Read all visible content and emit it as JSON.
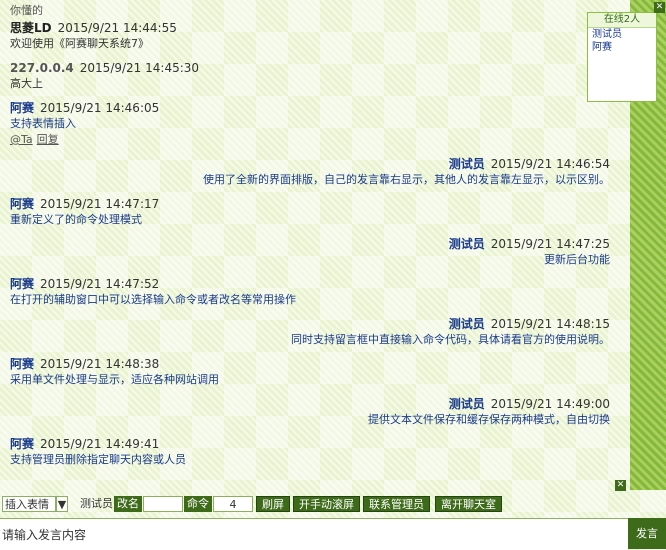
{
  "top_label": "你懂的",
  "online": {
    "header": "在线2人",
    "users": [
      "测试员",
      "阿赛"
    ]
  },
  "messages": [
    {
      "side": "left",
      "name": "思菱LD",
      "time": "2015/9/21 14:44:55",
      "text": "欢迎使用《阿赛聊天系统7》",
      "style": "dark"
    },
    {
      "side": "left",
      "name": "227.0.0.4",
      "time": "2015/9/21 14:45:30",
      "text": "高大上",
      "style": "gray"
    },
    {
      "side": "left",
      "name": "阿赛",
      "time": "2015/9/21 14:46:05",
      "text": "支持表情插入",
      "ops": [
        "@Ta",
        "回复"
      ]
    },
    {
      "side": "right",
      "name": "测试员",
      "time": "2015/9/21 14:46:54",
      "text": "使用了全新的界面排版，自己的发言靠右显示，其他人的发言靠左显示，以示区别。"
    },
    {
      "side": "left",
      "name": "阿赛",
      "time": "2015/9/21 14:47:17",
      "text": "重新定义了的命令处理模式"
    },
    {
      "side": "right",
      "name": "测试员",
      "time": "2015/9/21 14:47:25",
      "text": "更新后台功能"
    },
    {
      "side": "left",
      "name": "阿赛",
      "time": "2015/9/21 14:47:52",
      "text": "在打开的辅助窗口中可以选择输入命令或者改名等常用操作"
    },
    {
      "side": "right",
      "name": "测试员",
      "time": "2015/9/21 14:48:15",
      "text": "同时支持留言框中直接输入命令代码，具体请看官方的使用说明。"
    },
    {
      "side": "left",
      "name": "阿赛",
      "time": "2015/9/21 14:48:38",
      "text": "采用单文件处理与显示，适应各种网站调用"
    },
    {
      "side": "right",
      "name": "测试员",
      "time": "2015/9/21 14:49:00",
      "text": "提供文本文件保存和缓存保存两种模式，自由切换"
    },
    {
      "side": "left",
      "name": "阿赛",
      "time": "2015/9/21 14:49:41",
      "text": "支持管理员删除指定聊天内容或人员"
    }
  ],
  "toolbar": {
    "emoji_select": "插入表情",
    "user_name": "测试员",
    "rename_label": "改名",
    "command_label": "命令",
    "count_value": "4",
    "refresh_label": "刷屏",
    "manual_scroll": "开手动滚屏",
    "contact_admin": "联系管理员",
    "leave_room": "离开聊天室"
  },
  "input": {
    "placeholder": "请输入发言内容"
  },
  "send_label": "发言"
}
